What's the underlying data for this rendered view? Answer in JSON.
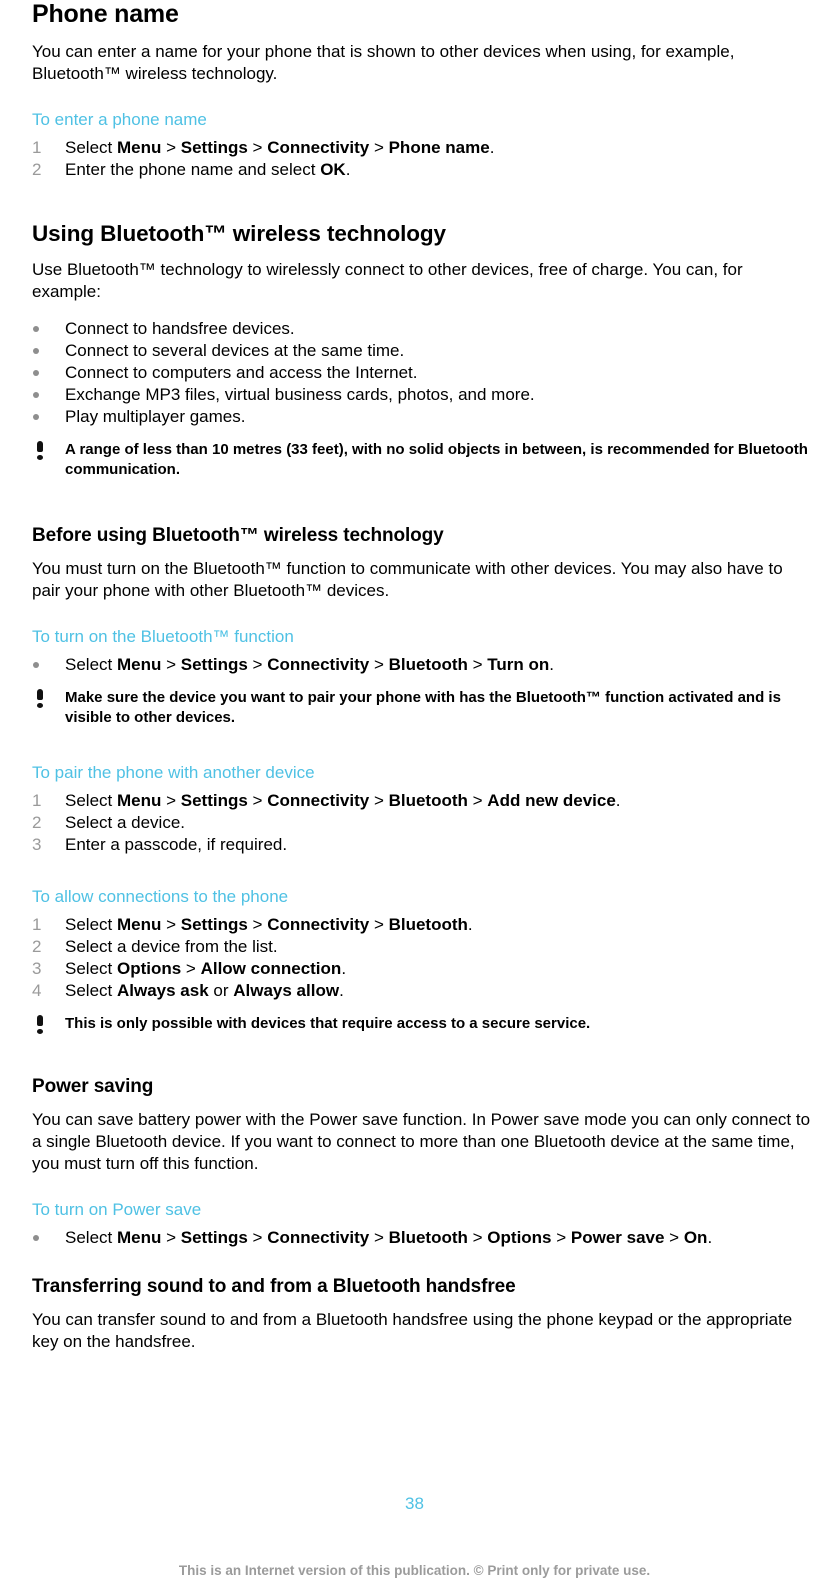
{
  "document": {
    "page_number": "38",
    "footer_note": "This is an Internet version of this publication. © Print only for private use.",
    "accent_color": "#4FC1E4",
    "marker_color": "#9a9a9a"
  },
  "sections": {
    "phone_name": {
      "heading": "Phone name",
      "intro": "You can enter a name for your phone that is shown to other devices when using, for example, Bluetooth™ wireless technology.",
      "task_heading": "To enter a phone name",
      "steps": [
        {
          "num": "1",
          "prefix": "Select ",
          "path": [
            "Menu",
            "Settings",
            "Connectivity",
            "Phone name"
          ],
          "suffix": "."
        },
        {
          "num": "2",
          "prefix": "Enter the phone name and select ",
          "path": [
            "OK"
          ],
          "suffix": "."
        }
      ]
    },
    "using_bluetooth": {
      "heading": "Using Bluetooth™ wireless technology",
      "intro": "Use Bluetooth™ technology to wirelessly connect to other devices, free of charge. You can, for example:",
      "bullets": [
        "Connect to handsfree devices.",
        "Connect to several devices at the same time.",
        "Connect to computers and access the Internet.",
        "Exchange MP3 files, virtual business cards, photos, and more.",
        "Play multiplayer games."
      ],
      "note": "A range of less than 10 metres (33 feet), with no solid objects in between, is recommended for Bluetooth communication."
    },
    "before_using": {
      "heading": "Before using Bluetooth™ wireless technology",
      "intro": "You must turn on the Bluetooth™ function to communicate with other devices. You may also have to pair your phone with other Bluetooth™ devices.",
      "task_turn_on": {
        "heading": "To turn on the Bluetooth™ function",
        "bullet": {
          "prefix": "Select ",
          "path": [
            "Menu",
            "Settings",
            "Connectivity",
            "Bluetooth",
            "Turn on"
          ],
          "suffix": "."
        }
      },
      "note": "Make sure the device you want to pair your phone with has the Bluetooth™ function activated and is visible to other devices.",
      "task_pair": {
        "heading": "To pair the phone with another device",
        "steps": [
          {
            "num": "1",
            "prefix": "Select ",
            "path": [
              "Menu",
              "Settings",
              "Connectivity",
              "Bluetooth",
              "Add new device"
            ],
            "suffix": "."
          },
          {
            "num": "2",
            "prefix": "Select a device.",
            "path": [],
            "suffix": ""
          },
          {
            "num": "3",
            "prefix": "Enter a passcode, if required.",
            "path": [],
            "suffix": ""
          }
        ]
      },
      "task_allow": {
        "heading": "To allow connections to the phone",
        "steps": [
          {
            "num": "1",
            "prefix": "Select ",
            "path": [
              "Menu",
              "Settings",
              "Connectivity",
              "Bluetooth"
            ],
            "suffix": "."
          },
          {
            "num": "2",
            "prefix": "Select a device from the list.",
            "path": [],
            "suffix": ""
          },
          {
            "num": "3",
            "prefix": "Select ",
            "path": [
              "Options",
              "Allow connection"
            ],
            "suffix": "."
          },
          {
            "num": "4",
            "prefix": "Select ",
            "path": [
              "Always ask"
            ],
            "joiner": " or ",
            "path2": [
              "Always allow"
            ],
            "suffix": "."
          }
        ]
      },
      "note2": "This is only possible with devices that require access to a secure service."
    },
    "power_saving": {
      "heading": "Power saving",
      "intro": "You can save battery power with the Power save function. In Power save mode you can only connect to a single Bluetooth device. If you want to connect to more than one Bluetooth device at the same time, you must turn off this function.",
      "task_heading": "To turn on Power save",
      "bullet": {
        "prefix": "Select ",
        "path": [
          "Menu",
          "Settings",
          "Connectivity",
          "Bluetooth",
          "Options",
          "Power save",
          "On"
        ],
        "suffix": "."
      }
    },
    "transferring_sound": {
      "heading": "Transferring sound to and from a Bluetooth handsfree",
      "intro": "You can transfer sound to and from a Bluetooth handsfree using the phone keypad or the appropriate key on the handsfree."
    }
  },
  "icons": {
    "note": "exclamation-note-icon",
    "bullet": "bullet-dot-icon"
  }
}
